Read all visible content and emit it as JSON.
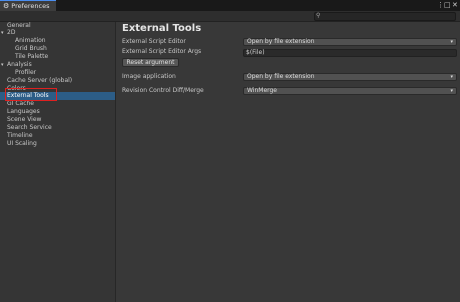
{
  "window": {
    "tab_title": "Preferences",
    "controls": {
      "more": "⋮",
      "maximize": "□",
      "close": "✕"
    }
  },
  "search": {
    "placeholder": "",
    "icon": "search-icon"
  },
  "sidebar": {
    "items": [
      {
        "label": "General",
        "indent": 0,
        "arrow": ""
      },
      {
        "label": "2D",
        "indent": 0,
        "arrow": "▾"
      },
      {
        "label": "Animation",
        "indent": 2,
        "arrow": ""
      },
      {
        "label": "Grid Brush",
        "indent": 2,
        "arrow": ""
      },
      {
        "label": "Tile Palette",
        "indent": 2,
        "arrow": ""
      },
      {
        "label": "Analysis",
        "indent": 0,
        "arrow": "▾"
      },
      {
        "label": "Profiler",
        "indent": 2,
        "arrow": ""
      },
      {
        "label": "Cache Server (global)",
        "indent": 0,
        "arrow": ""
      },
      {
        "label": "Colors",
        "indent": 0,
        "arrow": ""
      },
      {
        "label": "External Tools",
        "indent": 0,
        "arrow": "",
        "selected": true
      },
      {
        "label": "GI Cache",
        "indent": 0,
        "arrow": ""
      },
      {
        "label": "Languages",
        "indent": 0,
        "arrow": ""
      },
      {
        "label": "Scene View",
        "indent": 0,
        "arrow": ""
      },
      {
        "label": "Search Service",
        "indent": 0,
        "arrow": ""
      },
      {
        "label": "Timeline",
        "indent": 0,
        "arrow": ""
      },
      {
        "label": "UI Scaling",
        "indent": 0,
        "arrow": ""
      }
    ]
  },
  "main": {
    "title": "External Tools",
    "script_editor_label": "External Script Editor",
    "script_editor_value": "Open by file extension",
    "script_editor_args_label": "External Script Editor Args",
    "script_editor_args_value": "$(File)",
    "reset_button": "Reset argument",
    "image_app_label": "Image application",
    "image_app_value": "Open by file extension",
    "revision_label": "Revision Control Diff/Merge",
    "revision_value": "WinMerge"
  },
  "colors": {
    "selection": "#2c5d87",
    "highlight_box": "#e0201f",
    "tab_accent": "#4b8ef0"
  }
}
